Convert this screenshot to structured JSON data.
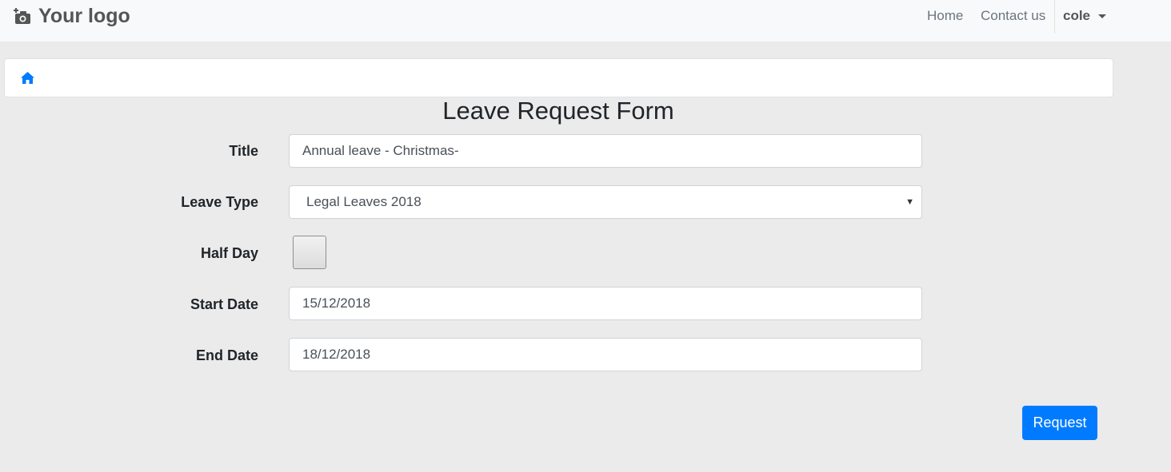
{
  "navbar": {
    "brand": "Your logo",
    "brand_icon": "camera-plus-icon",
    "links": [
      "Home",
      "Contact us"
    ],
    "user": "cole"
  },
  "breadcrumb": {
    "icon": "home-icon",
    "icon_color": "#007bff"
  },
  "form": {
    "title": "Leave Request Form",
    "fields": {
      "title_label": "Title",
      "title_value": "Annual leave - Christmas-",
      "leave_type_label": "Leave Type",
      "leave_type_value": "Legal Leaves 2018",
      "half_day_label": "Half Day",
      "half_day_checked": false,
      "start_date_label": "Start Date",
      "start_date_value": "15/12/2018",
      "end_date_label": "End Date",
      "end_date_value": "18/12/2018"
    },
    "submit_label": "Request",
    "submit_color": "#007bff"
  }
}
